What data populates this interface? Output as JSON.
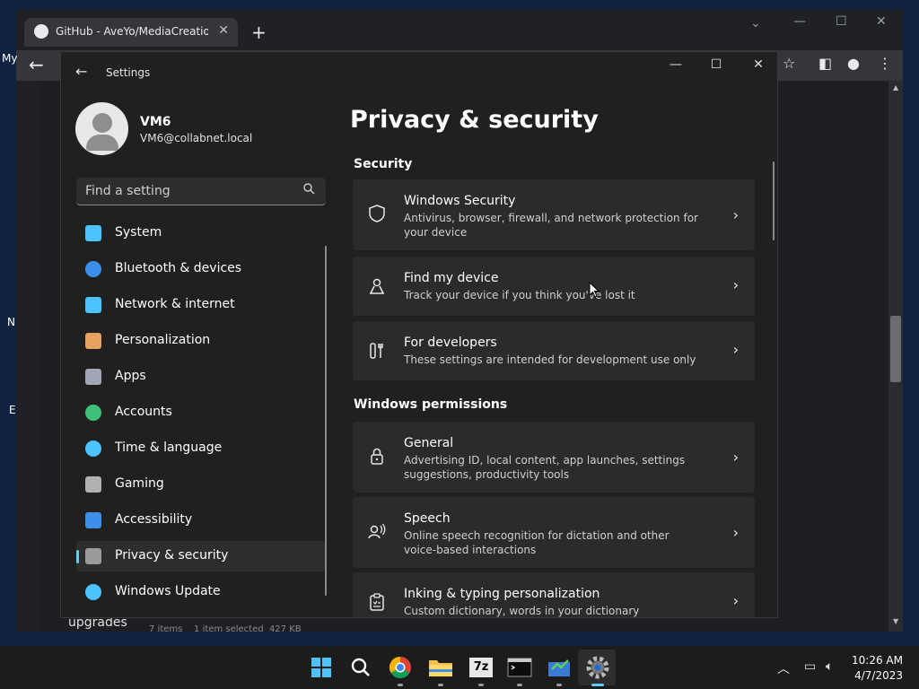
{
  "browser": {
    "tab_title": "GitHub - AveYo/MediaCreationTc",
    "new_tab": "+",
    "left_fragment_1": "My",
    "left_fragment_2": "N",
    "left_fragment_3": "E",
    "behind_text": "upgrades",
    "behind_status": "7 items    1 item selected  427 KB"
  },
  "settings": {
    "window_title": "Settings",
    "user": {
      "name": "VM6",
      "email": "VM6@collabnet.local"
    },
    "search_placeholder": "Find a setting",
    "nav": [
      {
        "label": "System",
        "icon": "system-icon",
        "color": "#4cc2ff"
      },
      {
        "label": "Bluetooth & devices",
        "icon": "bluetooth-icon",
        "color": "#3b8eea"
      },
      {
        "label": "Network & internet",
        "icon": "wifi-icon",
        "color": "#4cc2ff"
      },
      {
        "label": "Personalization",
        "icon": "brush-icon",
        "color": "#e8a060"
      },
      {
        "label": "Apps",
        "icon": "apps-icon",
        "color": "#a0a8b8"
      },
      {
        "label": "Accounts",
        "icon": "person-icon",
        "color": "#3fc07a"
      },
      {
        "label": "Time & language",
        "icon": "globe-clock-icon",
        "color": "#4cc2ff"
      },
      {
        "label": "Gaming",
        "icon": "controller-icon",
        "color": "#b0b0b0"
      },
      {
        "label": "Accessibility",
        "icon": "accessibility-icon",
        "color": "#3b8eea"
      },
      {
        "label": "Privacy & security",
        "icon": "shield-icon",
        "color": "#9a9a9a",
        "selected": true
      },
      {
        "label": "Windows Update",
        "icon": "update-icon",
        "color": "#4cc2ff"
      }
    ],
    "page_title": "Privacy & security",
    "security_heading": "Security",
    "permissions_heading": "Windows permissions",
    "security_cards": [
      {
        "title": "Windows Security",
        "desc": "Antivirus, browser, firewall, and network protection for your device",
        "icon": "shield-outline-icon"
      },
      {
        "title": "Find my device",
        "desc": "Track your device if you think you've lost it",
        "icon": "find-device-icon"
      },
      {
        "title": "For developers",
        "desc": "These settings are intended for development use only",
        "icon": "developer-tools-icon"
      }
    ],
    "permission_cards": [
      {
        "title": "General",
        "desc": "Advertising ID, local content, app launches, settings suggestions, productivity tools",
        "icon": "lock-icon"
      },
      {
        "title": "Speech",
        "desc": "Online speech recognition for dictation and other voice-based interactions",
        "icon": "speech-icon"
      },
      {
        "title": "Inking & typing personalization",
        "desc": "Custom dictionary, words in your dictionary",
        "icon": "clipboard-icon"
      }
    ]
  },
  "taskbar": {
    "time": "10:26 AM",
    "date": "4/7/2023",
    "apps": [
      "windows-start-icon",
      "search-icon",
      "chrome-icon",
      "file-explorer-icon",
      "7zip-icon",
      "terminal-icon",
      "network-app-icon",
      "settings-gear-icon"
    ],
    "sevenzip_label": "7z"
  }
}
